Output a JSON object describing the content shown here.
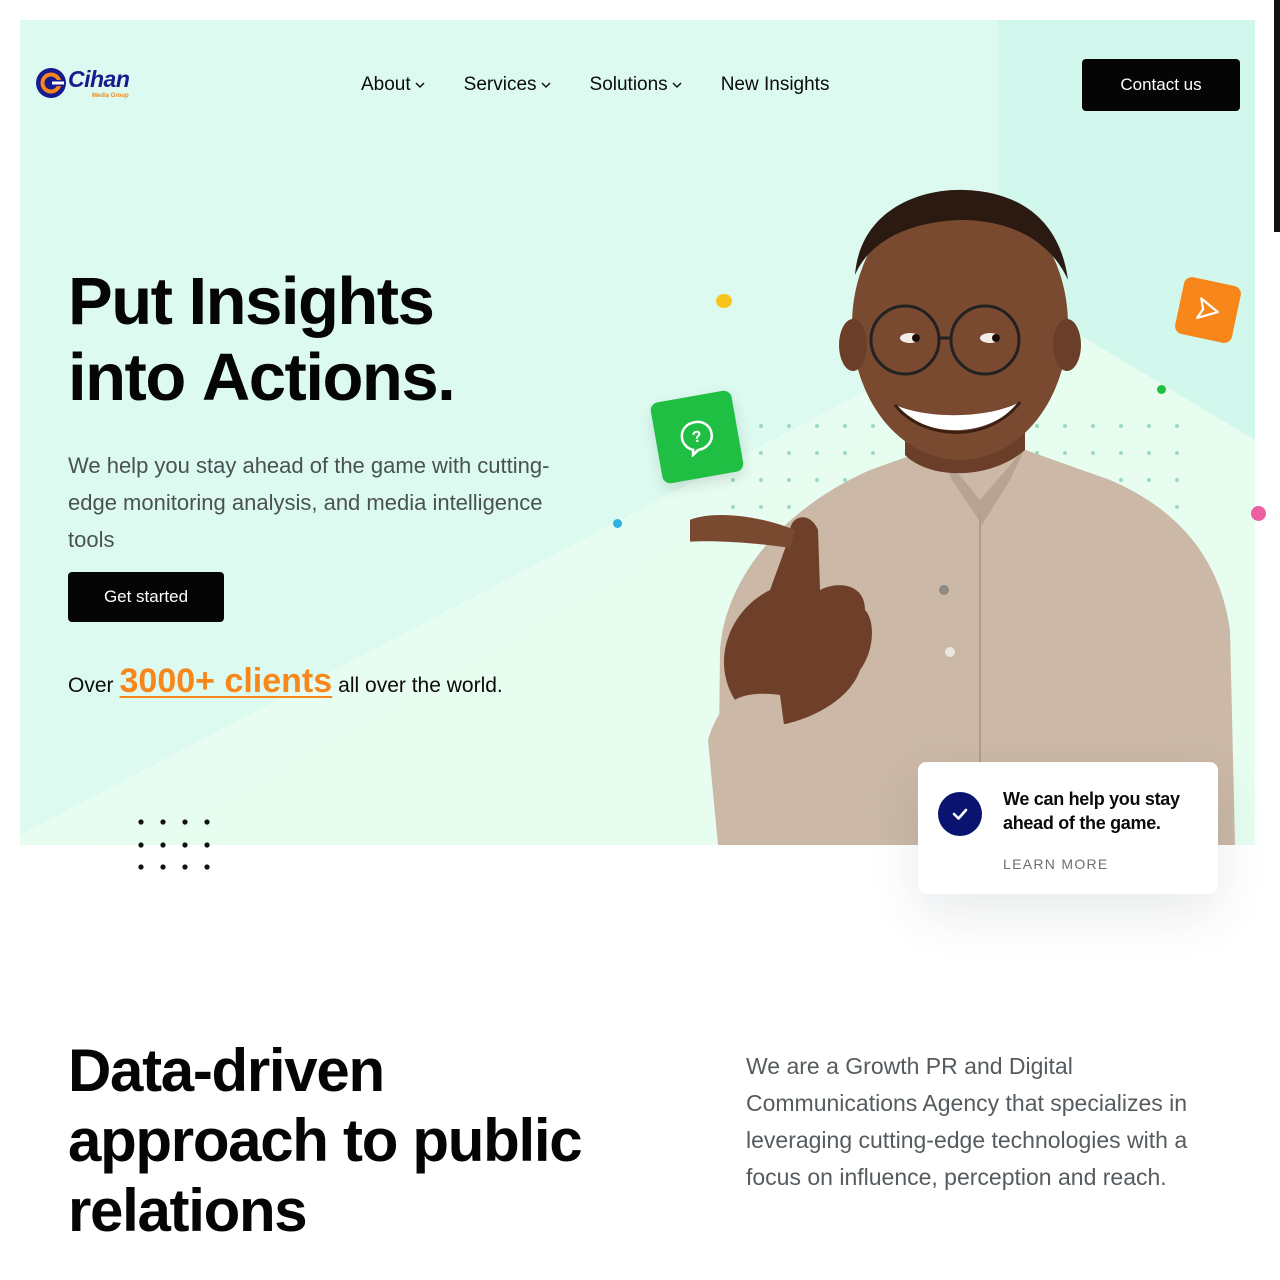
{
  "brand": {
    "name": "Cihan",
    "tagline": "Media Group"
  },
  "nav": {
    "items": [
      {
        "label": "About",
        "has_dropdown": true
      },
      {
        "label": "Services",
        "has_dropdown": true
      },
      {
        "label": "Solutions",
        "has_dropdown": true
      },
      {
        "label": "New Insights",
        "has_dropdown": false
      }
    ],
    "contact_label": "Contact us"
  },
  "hero": {
    "headline_line1": "Put Insights",
    "headline_line2_a": "into ",
    "headline_line2_b": "Actions.",
    "subtitle": "We help you stay ahead of the game with cutting-edge monitoring analysis, and media intelligence tools",
    "cta_label": "Get started",
    "clients_prefix": "Over",
    "clients_highlight": "3000+ clients",
    "clients_suffix": "all over the world."
  },
  "card": {
    "title": "We can help you stay ahead of the game.",
    "link_label": "LEARN MORE"
  },
  "section2": {
    "title_highlight": "Data-driven",
    "title_rest_line2": "approach to public",
    "title_rest_line3": "relations",
    "description": "We are a Growth PR and Digital Communications Agency that specializes in leveraging cutting-edge technologies with a focus on influence, perception and reach."
  },
  "icons": {
    "chevron": "chevron-down-icon",
    "question": "question-bubble-icon",
    "send": "send-icon",
    "check": "check-icon"
  },
  "colors": {
    "hero_bg": "#dcfaf0",
    "accent_orange": "#f7871a",
    "accent_green": "#1fbf44",
    "check_navy": "#0a1470",
    "button_black": "#050505"
  }
}
